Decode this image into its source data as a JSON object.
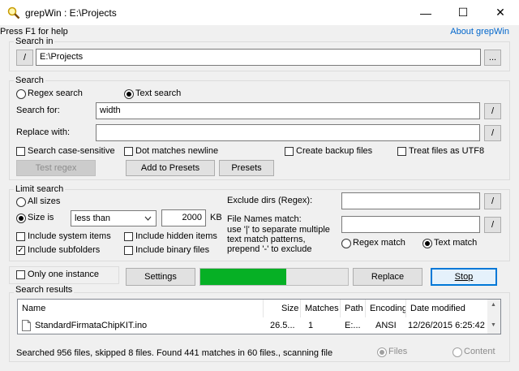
{
  "window": {
    "title": "grepWin : E:\\Projects",
    "minimize_glyph": "—",
    "maximize_glyph": "☐",
    "close_glyph": "✕",
    "accent_color": "#0078d7"
  },
  "help_text": "Press F1 for help",
  "about_link": "About grepWin",
  "search_in": {
    "group_label": "Search in",
    "slash_label": "/",
    "path": "E:\\Projects",
    "browse_label": "..."
  },
  "search": {
    "group_label": "Search",
    "regex_label": "Regex search",
    "text_label": "Text search",
    "mode_selected": "text",
    "search_for_label": "Search for:",
    "search_for_value": "width",
    "replace_with_label": "Replace with:",
    "replace_with_value": "",
    "slash_label": "/",
    "case_sensitive_label": "Search case-sensitive",
    "dot_newline_label": "Dot matches newline",
    "backup_label": "Create backup files",
    "utf8_label": "Treat files as UTF8",
    "test_regex_label": "Test regex",
    "add_presets_label": "Add to Presets",
    "presets_label": "Presets"
  },
  "limit": {
    "group_label": "Limit search",
    "all_sizes_label": "All sizes",
    "size_is_label": "Size is",
    "size_op": "less than",
    "size_value": "2000",
    "size_unit": "KB",
    "sys_items_label": "Include system items",
    "hidden_items_label": "Include hidden items",
    "subfolders_label": "Include subfolders",
    "binary_label": "Include binary files",
    "subfolders_checked": "✓",
    "exclude_dirs_label": "Exclude dirs (Regex):",
    "file_names_label": "File Names match:",
    "file_names_hint_1": "use '|' to separate multiple",
    "file_names_hint_2": "text match patterns,",
    "file_names_hint_3": "prepend '-' to exclude",
    "regex_match_label": "Regex match",
    "text_match_label": "Text match",
    "slash_label": "/"
  },
  "actions": {
    "one_instance_label": "Only one instance",
    "settings_label": "Settings",
    "progress": 0.58,
    "progress_color": "#06b025",
    "replace_label": "Replace",
    "stop_label": "Stop"
  },
  "results": {
    "group_label": "Search results",
    "columns": [
      "Name",
      "Size",
      "Matches",
      "Path",
      "Encoding",
      "Date modified"
    ],
    "rows": [
      {
        "name": "StandardFirmataChipKIT.ino",
        "size": "26.5...",
        "matches": "1",
        "path": "E:...",
        "encoding": "ANSI",
        "date": "12/26/2015 6:25:42 PM"
      }
    ],
    "scroll_up": "▲",
    "scroll_down": "▼"
  },
  "status": {
    "text": "Searched 956 files, skipped 8 files. Found 441 matches in 60 files., scanning file",
    "files_label": "Files",
    "content_label": "Content"
  }
}
